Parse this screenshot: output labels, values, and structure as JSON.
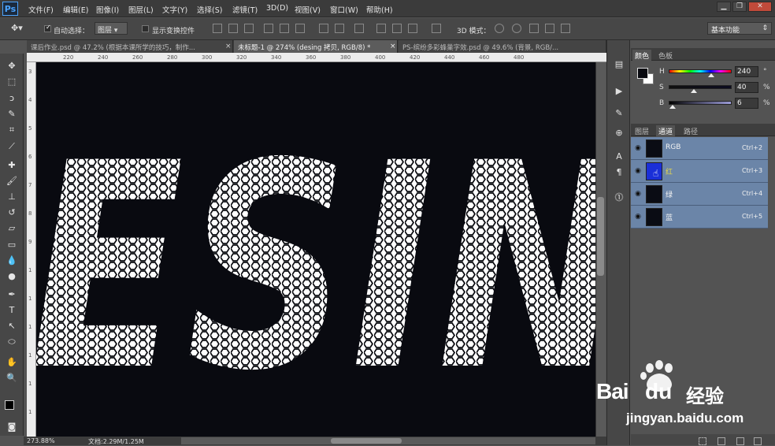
{
  "menubar": {
    "logo": "Ps",
    "items": [
      "文件(F)",
      "编辑(E)",
      "图像(I)",
      "图层(L)",
      "文字(Y)",
      "选择(S)",
      "滤镜(T)",
      "3D(D)",
      "视图(V)",
      "窗口(W)",
      "帮助(H)"
    ],
    "window_buttons": [
      "▁",
      "❐",
      "✕"
    ]
  },
  "options": {
    "auto_select_label": "自动选择：",
    "auto_select_value": "图层",
    "show_transform_label": "显示变换控件",
    "mode_3d_label": "3D 模式：",
    "workspace": "基本功能"
  },
  "tabs": [
    {
      "label": "课后作业.psd @ 47.2% (根据本课所学的技巧，制作...",
      "close": "×"
    },
    {
      "label": "未标题-1 @ 274% (desing 拷贝, RGB/8) *",
      "close": "×"
    },
    {
      "label": "PS-缤纷多彩蜂巢字效.psd @ 49.6% (背景, RGB/...",
      "close": "×"
    }
  ],
  "rulers": {
    "h_ticks": [
      "220",
      "240",
      "260",
      "280",
      "300",
      "320",
      "340",
      "360",
      "380",
      "400",
      "420",
      "440",
      "460",
      "480"
    ],
    "v_ticks": [
      "3",
      "4",
      "5",
      "6",
      "7",
      "8",
      "9",
      "1",
      "1",
      "1",
      "1",
      "1",
      "1"
    ]
  },
  "canvas": {
    "text": "ESIN",
    "background": "#090a10"
  },
  "status": {
    "zoom": "273.88%",
    "doc": "文档:2.29M/1.25M"
  },
  "color_panel": {
    "tabs": [
      "颜色",
      "色板"
    ],
    "sliders": [
      {
        "label": "H",
        "value": "240",
        "unit": "°",
        "level": 0.67
      },
      {
        "label": "S",
        "value": "40",
        "unit": "%",
        "level": 0.4
      },
      {
        "label": "B",
        "value": "6",
        "unit": "%",
        "level": 0.06
      }
    ]
  },
  "channels_panel": {
    "tabs": [
      "图层",
      "通道",
      "路径"
    ],
    "channels": [
      {
        "name": "RGB",
        "shortcut": "Ctrl+2"
      },
      {
        "name": "红",
        "shortcut": "Ctrl+3"
      },
      {
        "name": "绿",
        "shortcut": "Ctrl+4"
      },
      {
        "name": "蓝",
        "shortcut": "Ctrl+5"
      }
    ]
  },
  "watermark": {
    "brand": "Bai",
    "brand2": "du",
    "cn": "经验",
    "url": "jingyan.baidu.com"
  },
  "colors": {
    "accent": "#6b85a8",
    "panel": "#535353",
    "canvas": "#090a10"
  }
}
